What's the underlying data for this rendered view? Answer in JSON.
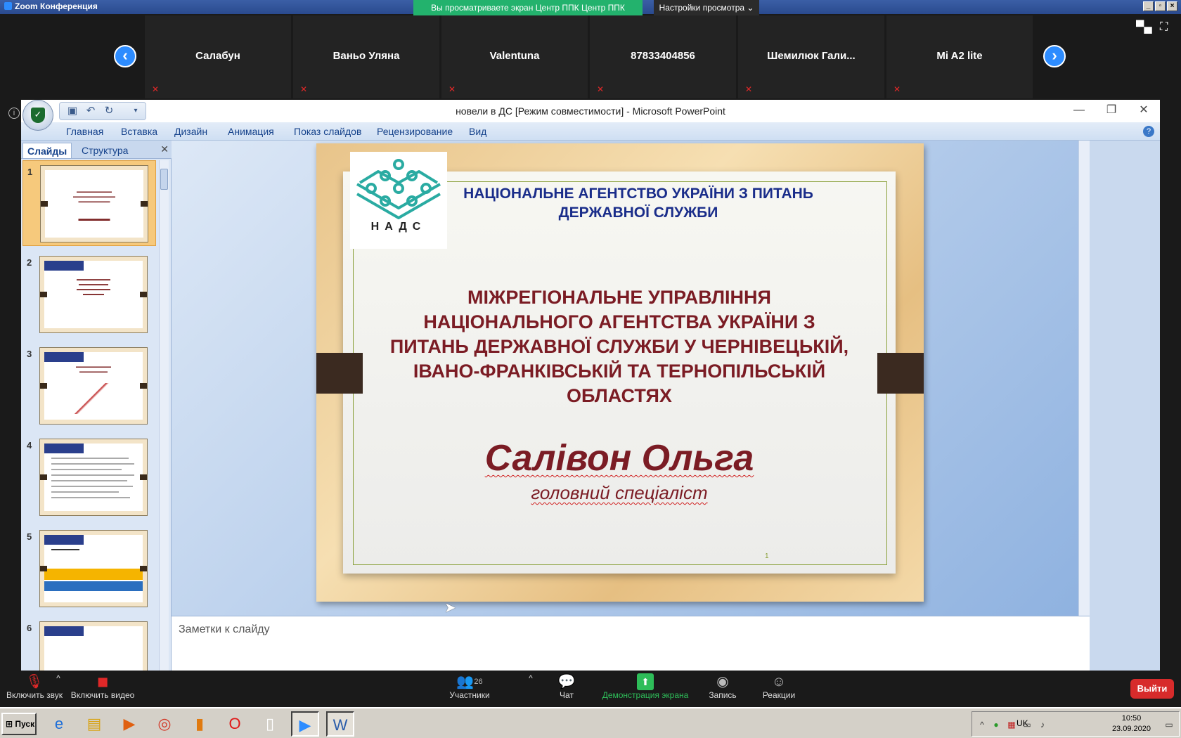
{
  "window": {
    "title": "Zoom Конференция",
    "share_banner": "Вы просматриваете экран Центр ППК Центр ППК",
    "view_options": "Настройки просмотра ⌄"
  },
  "participants": [
    "Салабун",
    "Ваньо Уляна",
    "Valentuna",
    "87833404856",
    "Шемилюк  Гали...",
    "Mi A2 lite"
  ],
  "ppt": {
    "title": "новели в ДС [Режим совместимости] - Microsoft PowerPoint",
    "ribbon_tabs": [
      "Главная",
      "Вставка",
      "Дизайн",
      "Анимация",
      "Показ слайдов",
      "Рецензирование",
      "Вид"
    ],
    "panel_tabs": [
      "Слайды",
      "Структура"
    ],
    "thumb_numbers": [
      "1",
      "2",
      "3",
      "4",
      "5",
      "6"
    ],
    "notes_placeholder": "Заметки к слайду"
  },
  "slide": {
    "logo_text": "НАДС",
    "agency": "НАЦІОНАЛЬНЕ АГЕНТСТВО УКРАЇНИ З ПИТАНЬ ДЕРЖАВНОЇ СЛУЖБИ",
    "main_title": "МІЖРЕГІОНАЛЬНЕ УПРАВЛІННЯ НАЦІОНАЛЬНОГО АГЕНТСТВА УКРАЇНИ З ПИТАНЬ ДЕРЖАВНОЇ СЛУЖБИ У ЧЕРНІВЕЦЬКІЙ, ІВАНО-ФРАНКІВСЬКІЙ ТА ТЕРНОПІЛЬСЬКІЙ ОБЛАСТЯХ",
    "name": "Салівон Ольга",
    "position": "головний спеціаліст",
    "page_number": "1"
  },
  "toolbar": {
    "unmute": "Включить звук",
    "start_video": "Включить видео",
    "participants_label": "Участники",
    "participants_count": "26",
    "chat": "Чат",
    "share": "Демонстрация экрана",
    "record": "Запись",
    "reactions": "Реакции",
    "leave": "Выйти"
  },
  "taskbar": {
    "start": "Пуск",
    "lang": "UK",
    "time": "10:50",
    "date": "23.09.2020"
  },
  "colors": {
    "zoom_blue": "#2d8cff",
    "share_green": "#23b26d",
    "slide_title": "#7b1c24",
    "agency_blue": "#1a2d8a",
    "leave_red": "#d72b2b"
  }
}
